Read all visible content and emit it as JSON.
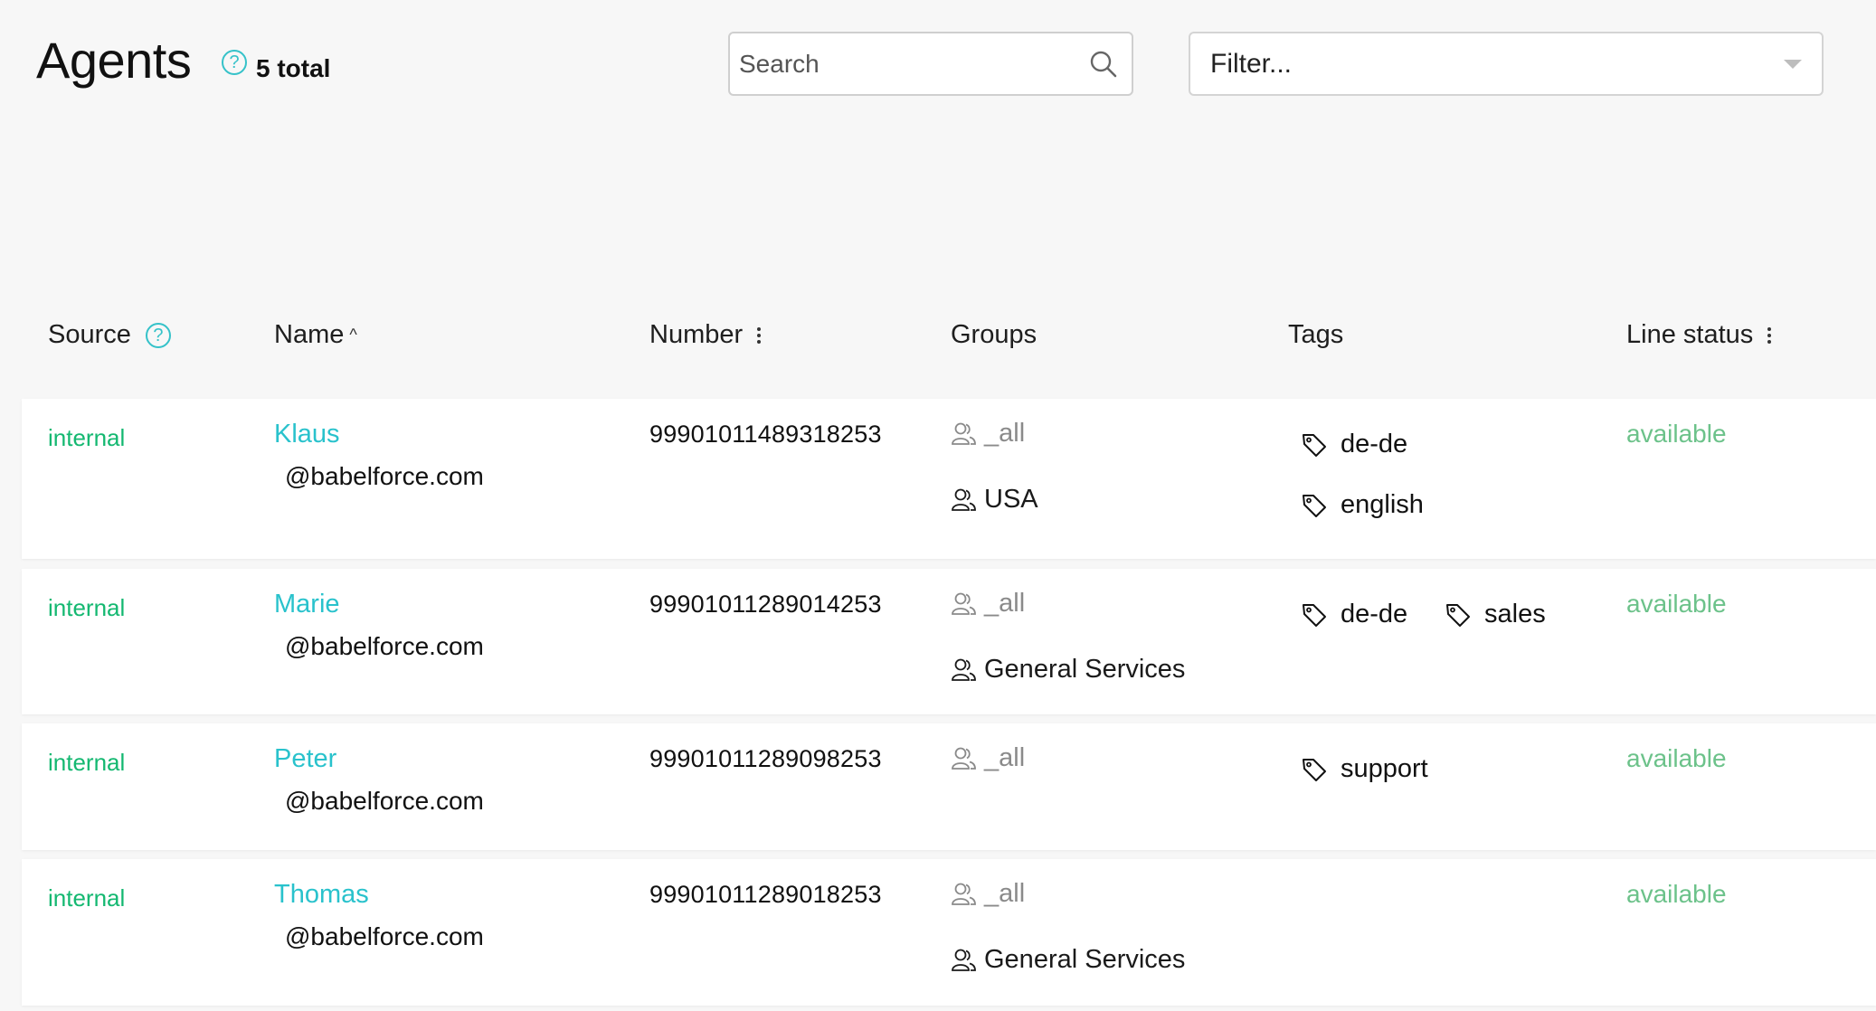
{
  "header": {
    "title": "Agents",
    "help": "?",
    "total": "5 total"
  },
  "search": {
    "placeholder": "Search"
  },
  "filter": {
    "label": "Filter..."
  },
  "columns": {
    "source": "Source",
    "name": "Name",
    "number": "Number",
    "groups": "Groups",
    "tags": "Tags",
    "line_status": "Line status",
    "sort_indicator": "^"
  },
  "rows": [
    {
      "source": "internal",
      "name": "Klaus",
      "email": "@babelforce.com",
      "number": "99901011489318253",
      "groups": [
        "_all",
        "USA"
      ],
      "tags": [
        "de-de",
        "english"
      ],
      "line_status": "available"
    },
    {
      "source": "internal",
      "name": "Marie",
      "email": "@babelforce.com",
      "number": "99901011289014253",
      "groups": [
        "_all",
        "General Services"
      ],
      "tags": [
        "de-de",
        "sales"
      ],
      "line_status": "available"
    },
    {
      "source": "internal",
      "name": "Peter",
      "email": "@babelforce.com",
      "number": "99901011289098253",
      "groups": [
        "_all"
      ],
      "tags": [
        "support"
      ],
      "line_status": "available"
    },
    {
      "source": "internal",
      "name": "Thomas",
      "email": "@babelforce.com",
      "number": "99901011289018253",
      "groups": [
        "_all",
        "General Services"
      ],
      "tags": [],
      "line_status": "available"
    }
  ],
  "colors": {
    "accent": "#29c2cc",
    "source_green": "#14b871",
    "status_green": "#6cc28a",
    "muted_text": "#8a8a8a"
  },
  "icons": {
    "search": "search-icon",
    "filter_caret": "caret-down-icon",
    "group": "user-group-icon",
    "tag": "tag-icon",
    "help": "help-icon",
    "column_menu": "column-menu-icon"
  }
}
